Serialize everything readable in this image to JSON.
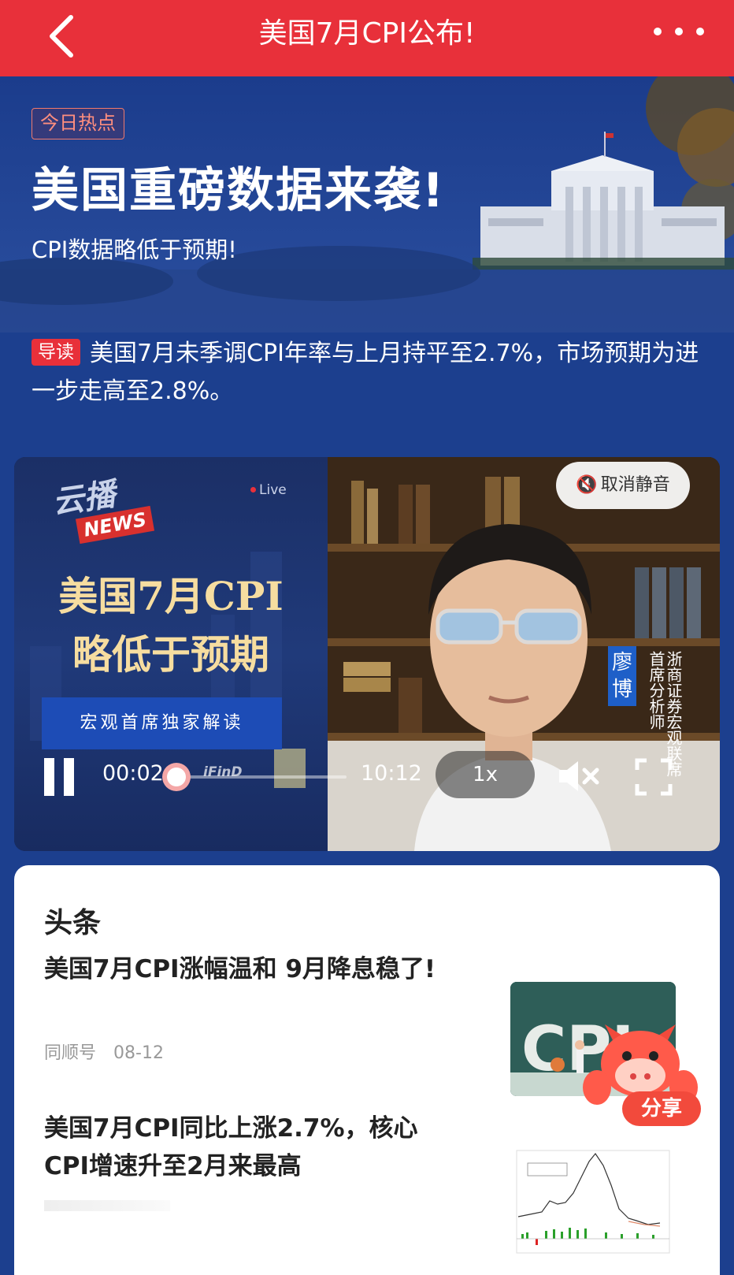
{
  "topbar": {
    "title": "美国7月CPI公布!"
  },
  "hero": {
    "badge": "今日热点",
    "title": "美国重磅数据来袭!",
    "subtitle": "CPI数据略低于预期!"
  },
  "lead": {
    "tag": "导读",
    "text": "美国7月未季调CPI年率与上月持平至2.7%，市场预期为进一步走高至2.8%。"
  },
  "video": {
    "logo": "云播",
    "news_tag": "NEWS",
    "live": "Live",
    "headline_line1": "美国7月CPI",
    "headline_line2": "略低于预期",
    "banner": "宏观首席独家解读",
    "unmute_label": "取消静音",
    "speaker_name": "廖博",
    "speaker_title": "浙商证券宏观联席首席分析师",
    "current_time": "00:02",
    "total_time": "10:12",
    "progress": 0.003,
    "speed": "1x",
    "watermark": "iFinD"
  },
  "headlines": {
    "section_title": "头条",
    "items": [
      {
        "title": "美国7月CPI涨幅温和 9月降息稳了!",
        "source": "同顺号",
        "date": "08-12",
        "thumb_text": "CPI"
      },
      {
        "title": "美国7月CPI同比上涨2.7%，核心CPI增速升至2月来最高",
        "source": "",
        "date": ""
      }
    ]
  },
  "share": {
    "label": "分享"
  },
  "colors": {
    "brand_red": "#e8303a",
    "hero_blue": "#1e3f8f",
    "headline_gold": "#f6dda0"
  }
}
